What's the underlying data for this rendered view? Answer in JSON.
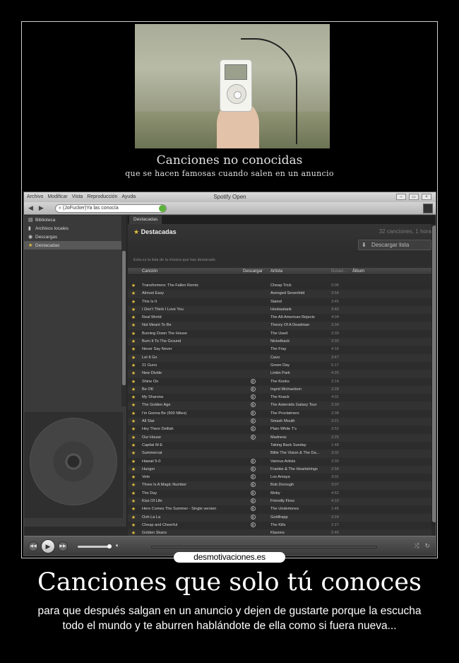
{
  "poster": {
    "caption_title": "Canciones no conocidas",
    "caption_sub": "que se hacen famosas cuando salen en un anuncio",
    "logo_text": "desmotivaciones.es",
    "title": "Canciones que solo tú conoces",
    "subtitle": "para que después salgan en un anuncio y dejen de gustarte porque la escucha todo el mundo y te aburren hablándote de ella como si fuera nueva..."
  },
  "window": {
    "title": "Spotify Open",
    "menu": [
      "Archivo",
      "Modificar",
      "Vista",
      "Reproducción",
      "Ayuda"
    ],
    "controls": [
      "–",
      "▭",
      "×"
    ],
    "search_value": "(JoFucker)Ya las conocía"
  },
  "sidebar": {
    "items": [
      {
        "icon": "library-icon",
        "label": "Biblioteca"
      },
      {
        "icon": "local-files-icon",
        "label": "Archivos locales"
      },
      {
        "icon": "download-icon",
        "label": "Descargas"
      },
      {
        "icon": "star-icon",
        "label": "Destacadas"
      }
    ]
  },
  "main": {
    "tab": "Destacadas",
    "heading": "Destacadas",
    "meta": "32 canciones, 1 hora",
    "download_label": "Descargar lista",
    "description": "Esta es la lista de la música que has destacado",
    "columns": [
      "Canción",
      "Descargar",
      "Artista",
      "Duraci...",
      "Álbum"
    ]
  },
  "tracks": [
    {
      "song": "Transformers: The Fallen Remix",
      "artist": "Cheap Trick",
      "dur": "5:06",
      "dl": false
    },
    {
      "song": "Almost Easy",
      "artist": "Avenged Sevenfold",
      "dur": "3:54",
      "dl": false
    },
    {
      "song": "This Is It",
      "artist": "Staind",
      "dur": "3:45",
      "dl": false
    },
    {
      "song": "I Don't Think I Love You",
      "artist": "Hoobastank",
      "dur": "3:40",
      "dl": false
    },
    {
      "song": "Real World",
      "artist": "The All-American Rejects",
      "dur": "4:04",
      "dl": false
    },
    {
      "song": "Not Meant To Be",
      "artist": "Theory Of A Deadman",
      "dur": "3:34",
      "dl": false
    },
    {
      "song": "Burning Down The House",
      "artist": "The Used",
      "dur": "3:39",
      "dl": false
    },
    {
      "song": "Burn It To The Ground",
      "artist": "Nickelback",
      "dur": "3:30",
      "dl": false
    },
    {
      "song": "Never Say Never",
      "artist": "The Fray",
      "dur": "4:16",
      "dl": false
    },
    {
      "song": "Let It Go",
      "artist": "Cavo",
      "dur": "3:47",
      "dl": false
    },
    {
      "song": "21 Guns",
      "artist": "Green Day",
      "dur": "5:17",
      "dl": false
    },
    {
      "song": "New Divide",
      "artist": "Linkin Park",
      "dur": "4:26",
      "dl": false
    },
    {
      "song": "Shine On",
      "artist": "The Kooks",
      "dur": "3:14",
      "dl": true
    },
    {
      "song": "Be OK",
      "artist": "Ingrid Michaelson",
      "dur": "2:28",
      "dl": true
    },
    {
      "song": "My Sharona",
      "artist": "The Knack",
      "dur": "4:01",
      "dl": true
    },
    {
      "song": "The Golden Age",
      "artist": "The Asteroids Galaxy Tour",
      "dur": "3:30",
      "dl": true
    },
    {
      "song": "I'm Gonna Be (500 Miles)",
      "artist": "The Proclaimers",
      "dur": "3:38",
      "dl": true
    },
    {
      "song": "All Star",
      "artist": "Smash Mouth",
      "dur": "3:21",
      "dl": true
    },
    {
      "song": "Hey There Delilah",
      "artist": "Plain White T's",
      "dur": "3:52",
      "dl": true
    },
    {
      "song": "Our House",
      "artist": "Madness",
      "dur": "3:25",
      "dl": true
    },
    {
      "song": "Capital M-E",
      "artist": "Taking Back Sunday",
      "dur": "1:48",
      "dl": false
    },
    {
      "song": "Summercat",
      "artist": "Billie The Vision & The Da...",
      "dur": "3:02",
      "dl": false
    },
    {
      "song": "Hawaii 5-0",
      "artist": "Various Artists",
      "dur": "3:30",
      "dl": true
    },
    {
      "song": "Hunger",
      "artist": "Frankie & The Heartstrings",
      "dur": "2:56",
      "dl": true
    },
    {
      "song": "Vete",
      "artist": "Los Amaya",
      "dur": "3:01",
      "dl": true
    },
    {
      "song": "Three Is A Magic Number",
      "artist": "Bob Dorough",
      "dur": "3:07",
      "dl": true
    },
    {
      "song": "The Day",
      "artist": "Moby",
      "dur": "4:52",
      "dl": true
    },
    {
      "song": "Kiss Of Life",
      "artist": "Friendly Fires",
      "dur": "4:10",
      "dl": true
    },
    {
      "song": "Here Comes The Summer - Single version",
      "artist": "The Undertones",
      "dur": "1:45",
      "dl": true
    },
    {
      "song": "Ooh La La",
      "artist": "Goldfrapp",
      "dur": "3:24",
      "dl": true
    },
    {
      "song": "Cheap and Cheerful",
      "artist": "The Kills",
      "dur": "2:27",
      "dl": true
    },
    {
      "song": "Golden Skans",
      "artist": "Klaxons",
      "dur": "2:46",
      "dl": false
    }
  ],
  "colors": {
    "star": "#e6c23a",
    "background": "#000000",
    "accent_green": "#5bb33b"
  }
}
